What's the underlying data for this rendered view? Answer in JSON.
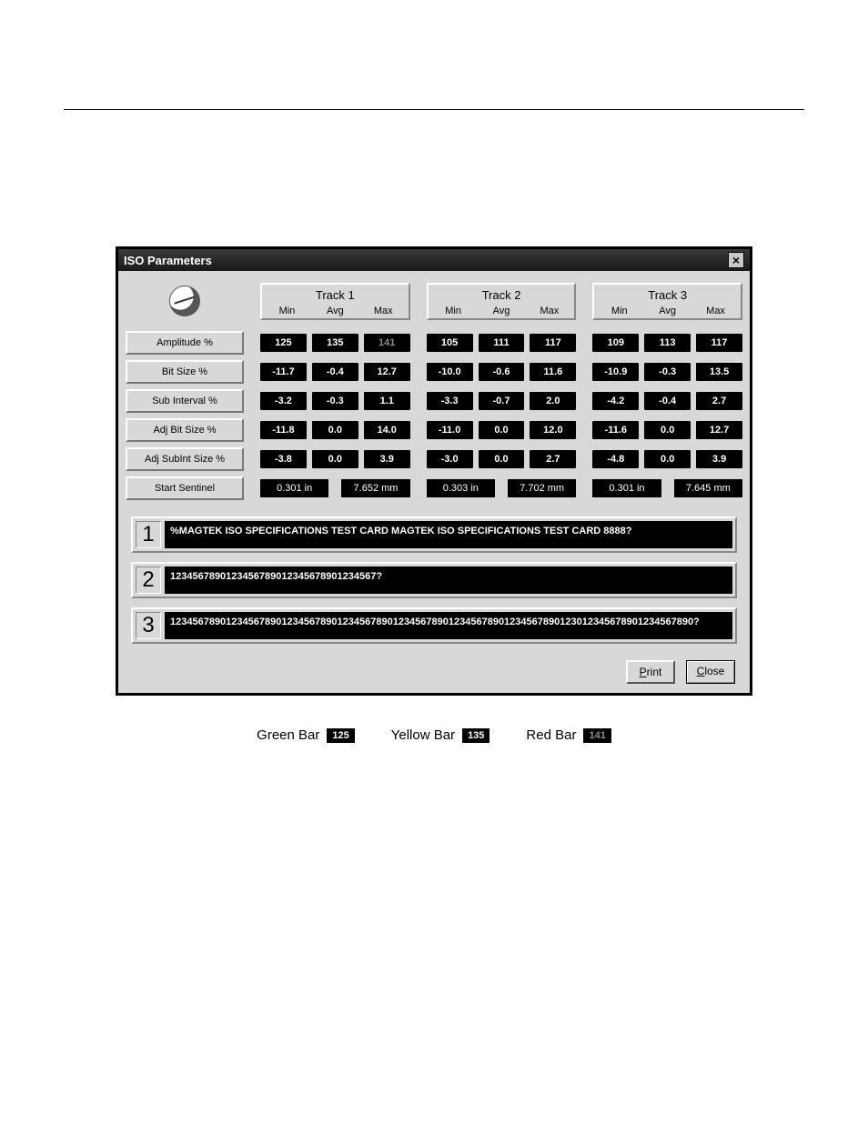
{
  "dialog": {
    "title": "ISO Parameters",
    "tracks": [
      "Track 1",
      "Track 2",
      "Track 3"
    ],
    "subheads": [
      "Min",
      "Avg",
      "Max"
    ],
    "rows": [
      {
        "label": "Amplitude %",
        "t1": {
          "min": "125",
          "avg": "135",
          "max": "141",
          "maxDim": true
        },
        "t2": {
          "min": "105",
          "avg": "111",
          "max": "117"
        },
        "t3": {
          "min": "109",
          "avg": "113",
          "max": "117"
        }
      },
      {
        "label": "Bit Size %",
        "t1": {
          "min": "-11.7",
          "avg": "-0.4",
          "max": "12.7"
        },
        "t2": {
          "min": "-10.0",
          "avg": "-0.6",
          "max": "11.6"
        },
        "t3": {
          "min": "-10.9",
          "avg": "-0.3",
          "max": "13.5"
        }
      },
      {
        "label": "Sub Interval %",
        "t1": {
          "min": "-3.2",
          "avg": "-0.3",
          "max": "1.1"
        },
        "t2": {
          "min": "-3.3",
          "avg": "-0.7",
          "max": "2.0"
        },
        "t3": {
          "min": "-4.2",
          "avg": "-0.4",
          "max": "2.7"
        }
      },
      {
        "label": "Adj Bit Size %",
        "t1": {
          "min": "-11.8",
          "avg": "0.0",
          "max": "14.0"
        },
        "t2": {
          "min": "-11.0",
          "avg": "0.0",
          "max": "12.0"
        },
        "t3": {
          "min": "-11.6",
          "avg": "0.0",
          "max": "12.7"
        }
      },
      {
        "label": "Adj SubInt Size %",
        "t1": {
          "min": "-3.8",
          "avg": "0.0",
          "max": "3.9"
        },
        "t2": {
          "min": "-3.0",
          "avg": "0.0",
          "max": "2.7"
        },
        "t3": {
          "min": "-4.8",
          "avg": "0.0",
          "max": "3.9"
        }
      }
    ],
    "sentinel": {
      "label": "Start Sentinel",
      "t1": {
        "in": "0.301 in",
        "mm": "7.652 mm"
      },
      "t2": {
        "in": "0.303 in",
        "mm": "7.702 mm"
      },
      "t3": {
        "in": "0.301 in",
        "mm": "7.645 mm"
      }
    },
    "strips": [
      {
        "n": "1",
        "text": "%MAGTEK ISO SPECIFICATIONS TEST CARD MAGTEK ISO SPECIFICATIONS TEST CARD 8888?"
      },
      {
        "n": "2",
        "text": "1234567890123456789012345678901234567?"
      },
      {
        "n": "3",
        "text": "1234567890123456789012345678901234567890123456789012345678901234567890123012345678901234567890?"
      }
    ],
    "buttons": {
      "print": "Print",
      "close": "Close"
    }
  },
  "legend": {
    "green": {
      "label": "Green Bar",
      "val": "125"
    },
    "yellow": {
      "label": "Yellow Bar",
      "val": "135"
    },
    "red": {
      "label": "Red Bar",
      "val": "141"
    }
  }
}
